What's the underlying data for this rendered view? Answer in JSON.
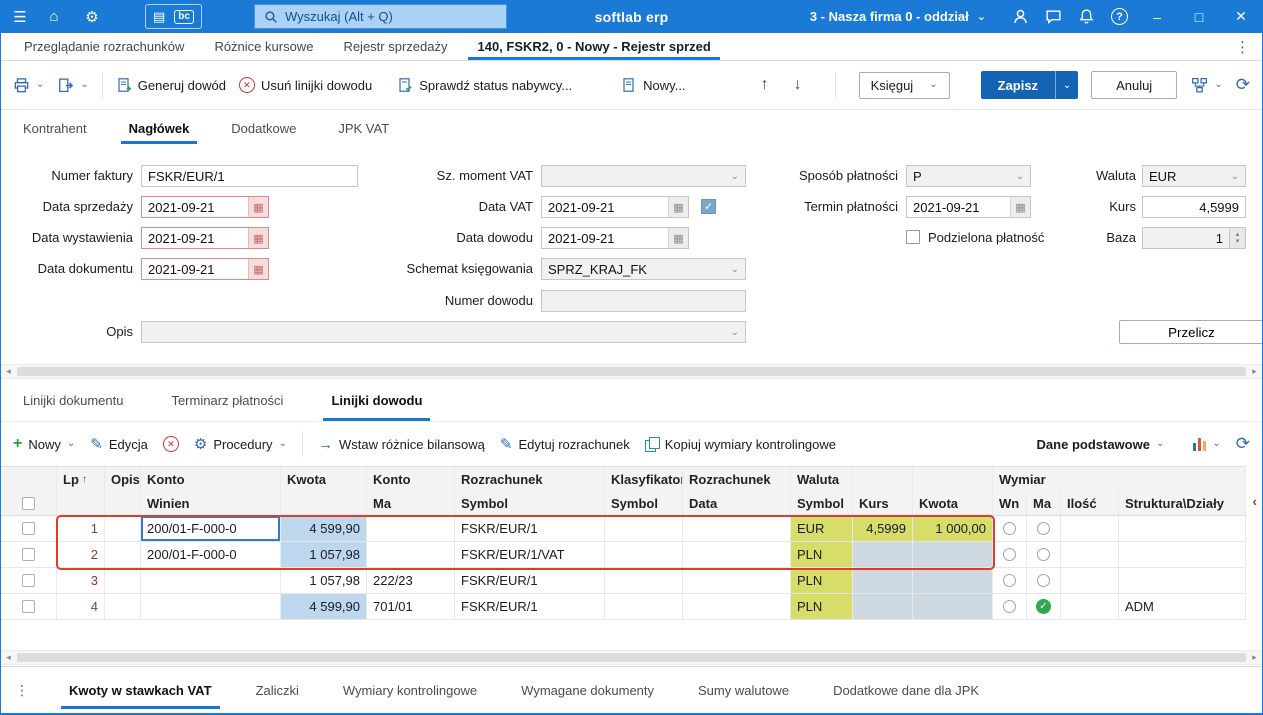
{
  "icons": {
    "menu": "☰",
    "home": "⌂",
    "settings": "⚙",
    "modules": "▤",
    "caret": "⌄",
    "minimize": "–",
    "maximize": "□",
    "close": "✕",
    "arrow_up": "↑",
    "arrow_down": "↓",
    "refresh": "⟳",
    "pencil": "✎",
    "plus": "+",
    "gear": "⚙",
    "arrow_right": "→",
    "more_v": "⋮",
    "sort_asc": "↑",
    "left_hint": "‹",
    "scroll_left": "◂",
    "scroll_right": "▸",
    "help": "?",
    "check": "✓",
    "calendar": "▦",
    "spin_up": "▴",
    "spin_down": "▾"
  },
  "topbar": {
    "search_placeholder": "Wyszukaj (Alt + Q)",
    "app_title": "softlab erp",
    "company": "3 - Nasza firma 0 - oddział",
    "bc_badge": "bc"
  },
  "doc_tabs": {
    "tab1": "Przeglądanie rozrachunków",
    "tab2": "Różnice kursowe",
    "tab3": "Rejestr sprzedaży",
    "tab4": "140, FSKR2, 0 - Nowy - Rejestr sprzed"
  },
  "toolbar": {
    "generuj_dowod": "Generuj dowód",
    "usun_linijki": "Usuń linijki dowodu",
    "sprawdz_status": "Sprawdź status nabywcy...",
    "nowy": "Nowy...",
    "ksieguj": "Księguj",
    "zapisz": "Zapisz",
    "anuluj": "Anuluj"
  },
  "form_tabs": {
    "tab1": "Kontrahent",
    "tab2": "Nagłówek",
    "tab3": "Dodatkowe",
    "tab4": "JPK VAT"
  },
  "form": {
    "numer_faktury": {
      "label": "Numer faktury",
      "value": "FSKR/EUR/1"
    },
    "data_sprzedazy": {
      "label": "Data sprzedaży",
      "value": "2021-09-21"
    },
    "data_wystawienia": {
      "label": "Data wystawienia",
      "value": "2021-09-21"
    },
    "data_dokumentu": {
      "label": "Data dokumentu",
      "value": "2021-09-21"
    },
    "opis": {
      "label": "Opis",
      "value": ""
    },
    "sz_moment_vat": {
      "label": "Sz. moment VAT",
      "value": ""
    },
    "data_vat": {
      "label": "Data VAT",
      "value": "2021-09-21"
    },
    "data_dowodu": {
      "label": "Data dowodu",
      "value": "2021-09-21"
    },
    "schemat_ksiegowania": {
      "label": "Schemat księgowania",
      "value": "SPRZ_KRAJ_FK"
    },
    "numer_dowodu": {
      "label": "Numer dowodu",
      "value": ""
    },
    "sposob_platnosci": {
      "label": "Sposób płatności",
      "value": "P"
    },
    "termin_platnosci": {
      "label": "Termin płatności",
      "value": "2021-09-21"
    },
    "podzielona_platnosc": {
      "label": "Podzielona płatność"
    },
    "waluta": {
      "label": "Waluta",
      "value": "EUR"
    },
    "kurs": {
      "label": "Kurs",
      "value": "4,5999"
    },
    "baza": {
      "label": "Baza",
      "value": "1"
    },
    "przelicz": "Przelicz"
  },
  "detail_tabs": {
    "tab1": "Linijki dokumentu",
    "tab2": "Terminarz płatności",
    "tab3": "Linijki dowodu"
  },
  "grid_toolbar": {
    "nowy": "Nowy",
    "edycja": "Edycja",
    "procedury": "Procedury",
    "wstaw_roznice": "Wstaw różnice bilansową",
    "edytuj_rozrachunek": "Edytuj rozrachunek",
    "kopiuj_wymiary": "Kopiuj wymiary kontrolingowe",
    "dane_podstawowe": "Dane podstawowe"
  },
  "grid": {
    "header_top": {
      "lp": "Lp",
      "opis": "Opis",
      "konto": "Konto",
      "kwota": "Kwota",
      "konto2": "Konto",
      "rozrachunek": "Rozrachunek",
      "klasyfikator": "Klasyfikator",
      "rozrachunek2": "Rozrachunek",
      "waluta": "Waluta",
      "wymiar": "Wymiar"
    },
    "header_bottom": {
      "winien": "Winien",
      "ma": "Ma",
      "symbol": "Symbol",
      "symbol2": "Symbol",
      "data": "Data",
      "symbol3": "Symbol",
      "kurs": "Kurs",
      "kwota": "Kwota",
      "wn": "Wn",
      "ma2": "Ma",
      "ilosc": "Ilość",
      "struktura": "Struktura\\Działy"
    },
    "rows": [
      {
        "lp": "1",
        "winien": "200/01-F-000-0",
        "kwota": "4 599,90",
        "ma": "",
        "symbol": "FSKR/EUR/1",
        "klasyfikator": "",
        "data": "",
        "waluta": "EUR",
        "kurs": "4,5999",
        "kwota2": "1 000,00",
        "ilosc": "",
        "struktura": ""
      },
      {
        "lp": "2",
        "winien": "200/01-F-000-0",
        "kwota": "1 057,98",
        "ma": "",
        "symbol": "FSKR/EUR/1/VAT",
        "klasyfikator": "",
        "data": "",
        "waluta": "PLN",
        "kurs": "",
        "kwota2": "",
        "ilosc": "",
        "struktura": ""
      },
      {
        "lp": "3",
        "winien": "",
        "kwota": "1 057,98",
        "ma": "222/23",
        "symbol": "FSKR/EUR/1",
        "klasyfikator": "",
        "data": "",
        "waluta": "PLN",
        "kurs": "",
        "kwota2": "",
        "ilosc": "",
        "struktura": ""
      },
      {
        "lp": "4",
        "winien": "",
        "kwota": "4 599,90",
        "ma": "701/01",
        "symbol": "FSKR/EUR/1",
        "klasyfikator": "",
        "data": "",
        "waluta": "PLN",
        "kurs": "",
        "kwota2": "",
        "ilosc": "",
        "struktura": "ADM"
      }
    ]
  },
  "bottom_tabs": {
    "tab1": "Kwoty w stawkach VAT",
    "tab2": "Zaliczki",
    "tab3": "Wymiary kontrolingowe",
    "tab4": "Wymagane dokumenty",
    "tab5": "Sumy walutowe",
    "tab6": "Dodatkowe dane dla JPK"
  }
}
